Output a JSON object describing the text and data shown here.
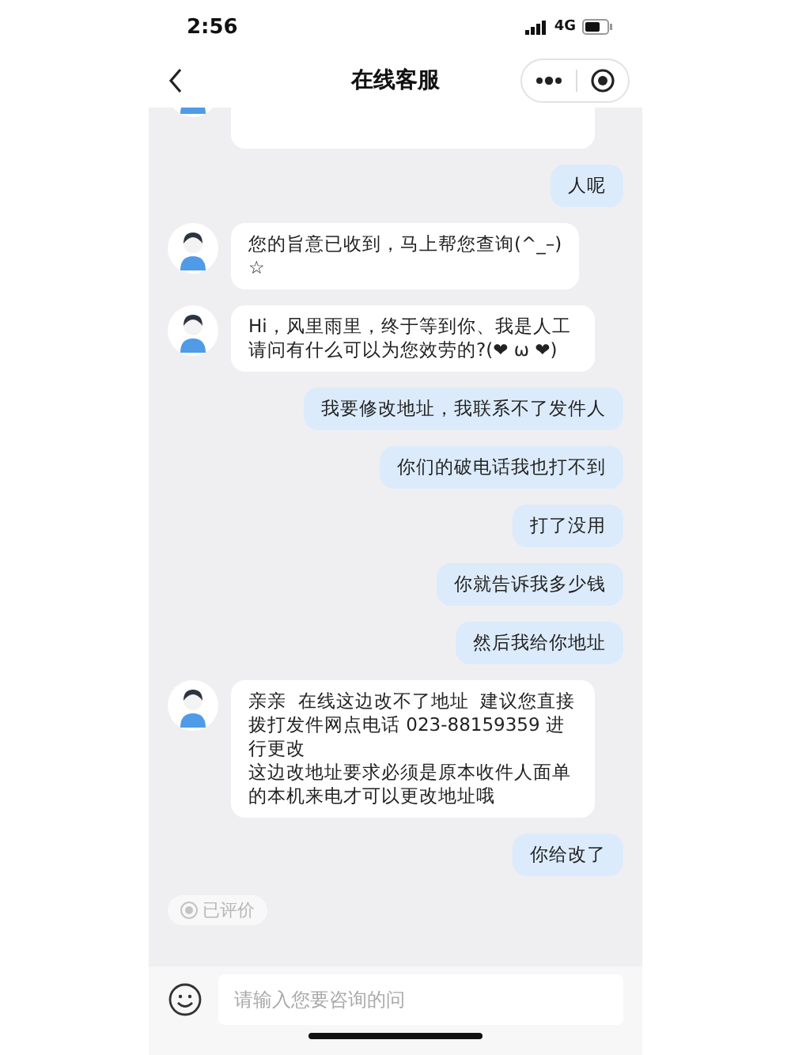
{
  "status_bar": {
    "time": "2:56",
    "network": "4G"
  },
  "header": {
    "title": "在线客服"
  },
  "messages": [
    {
      "kind": "partial"
    },
    {
      "kind": "user",
      "text": "人呢"
    },
    {
      "kind": "bot",
      "text": "您的旨意已收到，马上帮您查询(^_–)\n☆"
    },
    {
      "kind": "bot",
      "text": "Hi，风里雨里，终于等到你、我是人工请问有什么可以为您效劳的?(❤ ω ❤)"
    },
    {
      "kind": "user",
      "text": "我要修改地址，我联系不了发件人"
    },
    {
      "kind": "user",
      "text": "你们的破电话我也打不到"
    },
    {
      "kind": "user",
      "text": "打了没用"
    },
    {
      "kind": "user",
      "text": "你就告诉我多少钱"
    },
    {
      "kind": "user",
      "text": "然后我给你地址"
    },
    {
      "kind": "bot",
      "lines": [
        "亲亲  在线这边改不了地址  建议您直接拨打发件网点电话 023-88159359 进行更改",
        "这边改地址要求必须是原本收件人面单的本机来电才可以更改地址哦"
      ]
    },
    {
      "kind": "user",
      "text": "你给改了"
    }
  ],
  "rating": {
    "label": "已评价"
  },
  "input": {
    "placeholder": "请输入您要咨询的问"
  }
}
